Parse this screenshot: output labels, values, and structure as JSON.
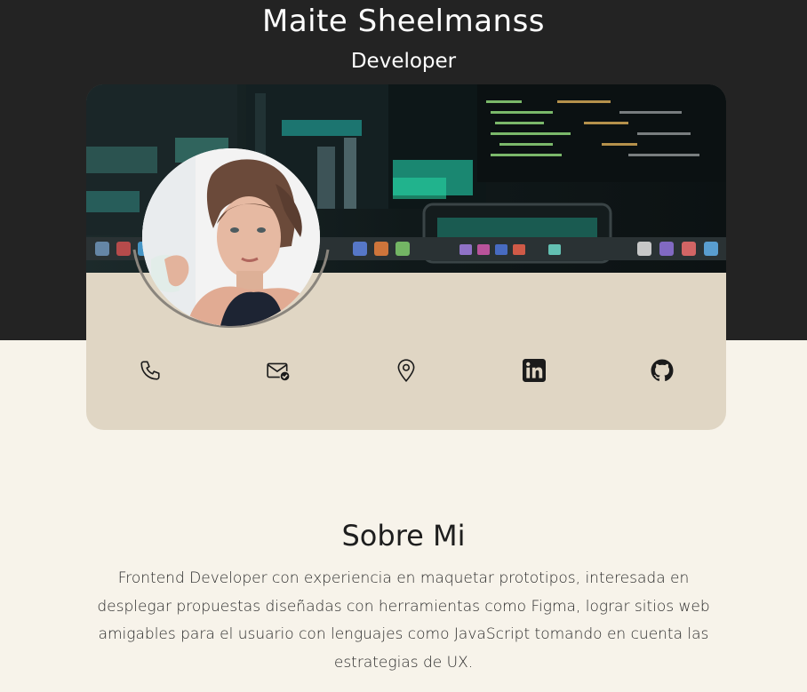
{
  "profile": {
    "name": "Maite Sheelmanss",
    "role": "Developer"
  },
  "contacts": [
    {
      "icon": "phone-icon"
    },
    {
      "icon": "mail-check-icon"
    },
    {
      "icon": "location-pin-icon"
    },
    {
      "icon": "linkedin-icon"
    },
    {
      "icon": "github-icon"
    }
  ],
  "about": {
    "title": "Sobre Mi",
    "text": "Frontend Developer con experiencia en maquetar prototipos, interesada en desplegar propuestas diseñadas con herramientas como Figma, lograr sitios web amigables para el usuario con lenguajes como JavaScript tomando en cuenta las estrategias de UX."
  },
  "colors": {
    "header_bg": "#232323",
    "page_bg": "#f7f3ea",
    "card_bg": "#e0d6c4",
    "text_dark": "#1e1e1e"
  }
}
